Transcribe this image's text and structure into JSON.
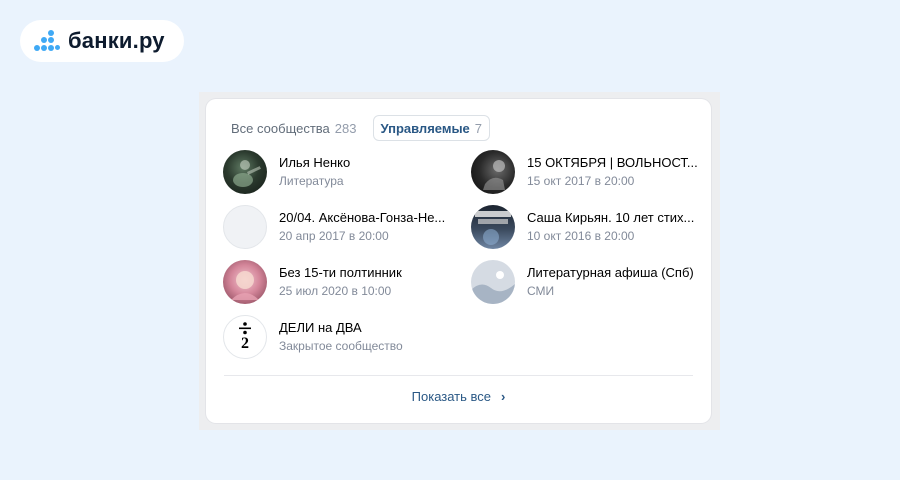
{
  "brand": {
    "logo_text": "банки.ру",
    "accent": "#3fa9f5"
  },
  "tabs": [
    {
      "label": "Все сообщества",
      "count": "283"
    },
    {
      "label": "Управляемые",
      "count": "7"
    }
  ],
  "communities": [
    {
      "title": "Илья Ненко",
      "subtitle": "Литература",
      "avatar": "photo-guitarist-dark"
    },
    {
      "title": "15 ОКТЯБРЯ | ВОЛЬНОСТ...",
      "subtitle": "15 окт 2017 в 20:00",
      "avatar": "photo-concert-bw"
    },
    {
      "title": "20/04. Аксёнова-Гонза-Не...",
      "subtitle": "20 апр 2017 в 20:00",
      "avatar": "empty-gray"
    },
    {
      "title": "Саша Кирьян. 10 лет стих...",
      "subtitle": "10 окт 2016 в 20:00",
      "avatar": "poster-sasha-kiryan"
    },
    {
      "title": "Без 15-ти полтинник",
      "subtitle": "25 июл 2020 в 10:00",
      "avatar": "photo-baby-pink"
    },
    {
      "title": "Литературная афиша (Спб)",
      "subtitle": "СМИ",
      "avatar": "placeholder-landscape-icon"
    },
    {
      "title": "ДЕЛИ на ДВА",
      "subtitle": "Закрытое сообщество",
      "avatar": "division-sign-logo",
      "avatar_digit": "2"
    }
  ],
  "footer": {
    "show_all_label": "Показать все",
    "chevron": "›"
  },
  "colors": {
    "link": "#2a5885",
    "secondary": "#828a99",
    "background": "#eaf3fd"
  }
}
